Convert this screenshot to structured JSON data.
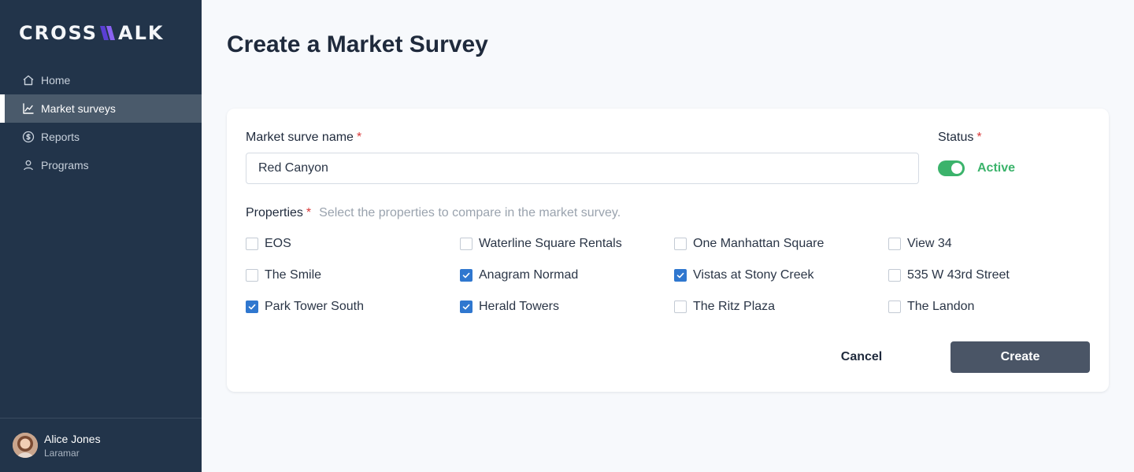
{
  "brand": {
    "logo_left": "CROSS",
    "logo_right": "ALK",
    "accent": "#6d4be6"
  },
  "sidebar": {
    "items": [
      {
        "label": "Home",
        "icon": "home-icon",
        "active": false
      },
      {
        "label": "Market surveys",
        "icon": "chart-line-icon",
        "active": true
      },
      {
        "label": "Reports",
        "icon": "dollar-circle-icon",
        "active": false
      },
      {
        "label": "Programs",
        "icon": "user-icon",
        "active": false
      }
    ],
    "user": {
      "name": "Alice Jones",
      "org": "Laramar"
    }
  },
  "main": {
    "title": "Create a Market Survey",
    "form": {
      "name_label": "Market surve name",
      "name_value": "Red Canyon",
      "status_label": "Status",
      "status_value": "Active",
      "status_on": true,
      "properties_label": "Properties",
      "properties_hint": "Select the properties to compare in the market survey.",
      "properties": [
        {
          "label": "EOS",
          "checked": false
        },
        {
          "label": "Waterline Square Rentals",
          "checked": false
        },
        {
          "label": "One Manhattan Square",
          "checked": false
        },
        {
          "label": "View 34",
          "checked": false
        },
        {
          "label": "The Smile",
          "checked": false
        },
        {
          "label": "Anagram Normad",
          "checked": true
        },
        {
          "label": "Vistas at Stony Creek",
          "checked": true
        },
        {
          "label": "535 W 43rd Street",
          "checked": false
        },
        {
          "label": "Park Tower South",
          "checked": true
        },
        {
          "label": "Herald Towers",
          "checked": true
        },
        {
          "label": "The Ritz Plaza",
          "checked": false
        },
        {
          "label": "The Landon",
          "checked": false
        }
      ],
      "cancel_label": "Cancel",
      "create_label": "Create"
    }
  },
  "colors": {
    "sidebar_bg": "#22344a",
    "active_status": "#3bb36b",
    "checkbox_checked": "#2f77cf",
    "required": "#d93838",
    "create_button": "#4a5566"
  }
}
